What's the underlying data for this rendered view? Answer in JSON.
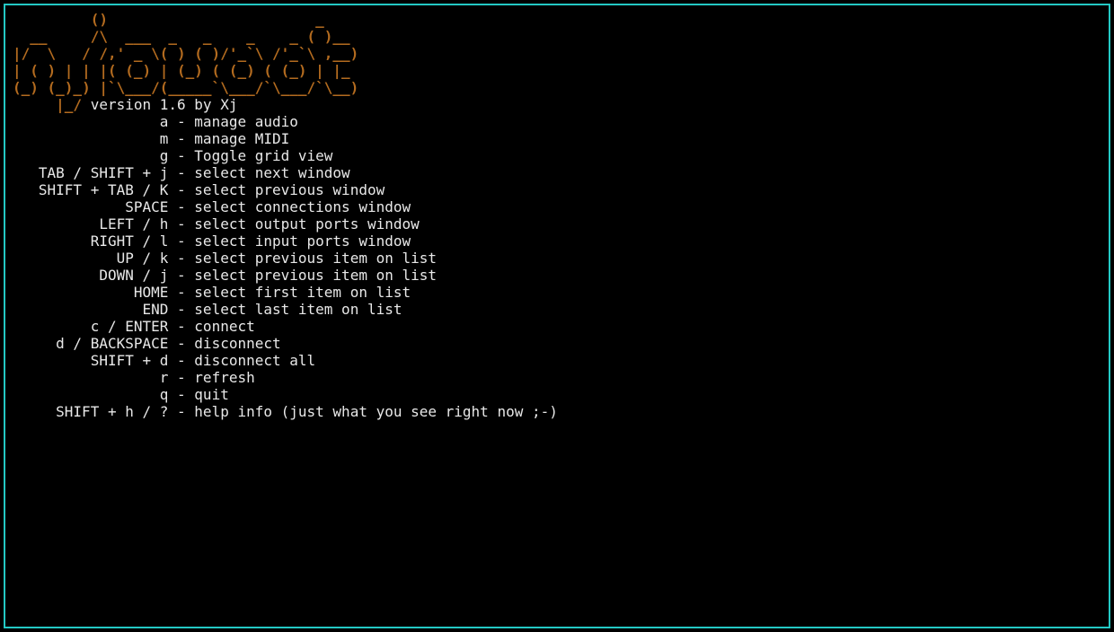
{
  "ascii_logo": "         ()                        _\n  __     /\\  ___  _   _    _    _ ( )__\n|/  \\   / /,' _ \\( ) ( )/'_`\\ /'_`\\ ,__)\n| ( ) | | |( (_) | (_) ( (_) ( (_) | |_\n(_) (_)_) |`\\___/(_____`\\___/`\\___/`\\__)",
  "version_prefix": "     |_/ ",
  "version_text": "version 1.6 by Xj",
  "help": [
    {
      "key": "a",
      "desc": "manage audio"
    },
    {
      "key": "m",
      "desc": "manage MIDI"
    },
    {
      "key": "g",
      "desc": "Toggle grid view"
    },
    {
      "key": "TAB / SHIFT + j",
      "desc": "select next window"
    },
    {
      "key": "SHIFT + TAB / K",
      "desc": "select previous window"
    },
    {
      "key": "SPACE",
      "desc": "select connections window"
    },
    {
      "key": "LEFT / h",
      "desc": "select output ports window"
    },
    {
      "key": "RIGHT / l",
      "desc": "select input ports window"
    },
    {
      "key": "UP / k",
      "desc": "select previous item on list"
    },
    {
      "key": "DOWN / j",
      "desc": "select previous item on list"
    },
    {
      "key": "HOME",
      "desc": "select first item on list"
    },
    {
      "key": "END",
      "desc": "select last item on list"
    },
    {
      "key": "c / ENTER",
      "desc": "connect"
    },
    {
      "key": "d / BACKSPACE",
      "desc": "disconnect"
    },
    {
      "key": "SHIFT + d",
      "desc": "disconnect all"
    },
    {
      "key": "r",
      "desc": "refresh"
    },
    {
      "key": "q",
      "desc": "quit"
    },
    {
      "key": "SHIFT + h / ?",
      "desc": "help info (just what you see right now ;-)"
    }
  ],
  "separator": " - "
}
